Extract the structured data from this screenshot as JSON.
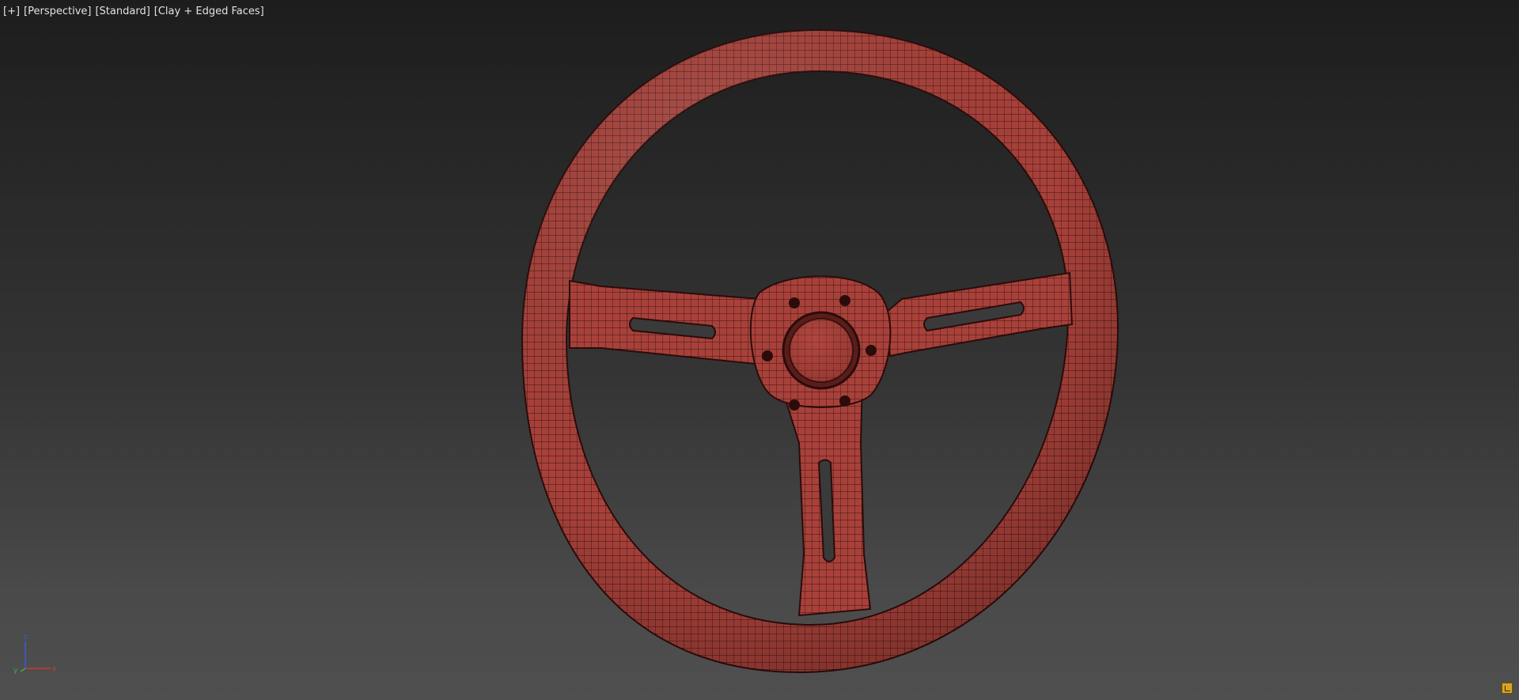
{
  "viewport": {
    "labels": {
      "general": "[+]",
      "view": "[Perspective]",
      "shading_mode": "[Standard]",
      "display_style": "[Clay + Edged Faces]"
    },
    "axis": {
      "x": "x",
      "y": "y",
      "z": "z"
    },
    "colors": {
      "background_top": "#1d1d1d",
      "background_bottom": "#4f4f4f",
      "model_clay": "#a8413a",
      "model_edges": "#2a0c0a",
      "label_text": "#e2e2e2",
      "axis_x": "#d03a2a",
      "axis_y": "#3fae3f",
      "axis_z": "#3a5ad8"
    },
    "model": "steering-wheel",
    "corner_icon": "viewport-layout-icon"
  }
}
